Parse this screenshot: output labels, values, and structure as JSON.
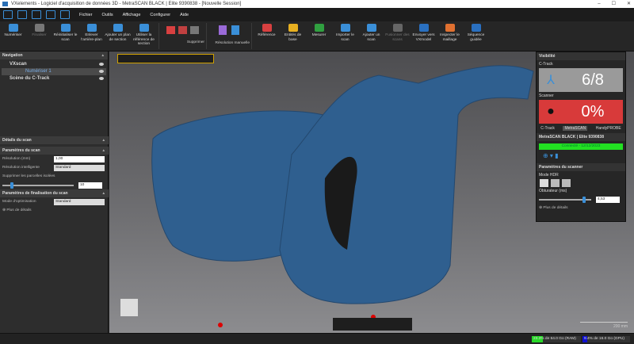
{
  "window": {
    "title": "VXelements - Logiciel d'acquisition de données 3D - MetraSCAN BLACK | Elite 9390838 - [Nouvelle Session]",
    "min": "–",
    "max": "☐",
    "close": "✕"
  },
  "menu": [
    "Fichier",
    "Outils",
    "Affichage",
    "Configurer",
    "Aide"
  ],
  "ribbon": {
    "buttons": [
      {
        "label": "Numériser",
        "color": "#3a8fd8",
        "enabled": true
      },
      {
        "label": "Finaliser",
        "color": "#777777",
        "enabled": false
      },
      {
        "label": "Réinitialiser le scan",
        "color": "#3a8fd8",
        "enabled": true
      },
      {
        "label": "Enlever l'arrière-plan",
        "color": "#3a8fd8",
        "enabled": true
      },
      {
        "label": "Ajouter un plan de section",
        "color": "#3a8fd8",
        "enabled": true
      },
      {
        "label": "Utiliser la référence de section",
        "color": "#3a8fd8",
        "enabled": true
      }
    ],
    "group_delete": "Supprimer",
    "group_resolution": "Résolution manuelle",
    "buttons2": [
      {
        "label": "Référence",
        "color": "#d84040",
        "enabled": true
      },
      {
        "label": "Entités de base",
        "color": "#e8b020",
        "enabled": true
      },
      {
        "label": "Mesurer",
        "color": "#30a040",
        "enabled": true
      },
      {
        "label": "Importer le scan",
        "color": "#3a8fd8",
        "enabled": true
      },
      {
        "label": "Ajouter un scan",
        "color": "#3a8fd8",
        "enabled": true
      },
      {
        "label": "Fusionner des scans",
        "color": "#666666",
        "enabled": false
      },
      {
        "label": "Envoyer vers VXmodel",
        "color": "#2a70c0",
        "enabled": true
      },
      {
        "label": "Inspecter le maillage",
        "color": "#e07030",
        "enabled": true
      },
      {
        "label": "Séquence guidée",
        "color": "#2a70c0",
        "enabled": true
      }
    ]
  },
  "left": {
    "navigation": "Navigation",
    "tree": {
      "root": "VXscan",
      "child": "Numériser 1",
      "ctrack": "Scène du C-Track"
    },
    "details": "Détails du scan",
    "scan_params": {
      "title": "Paramètres du scan",
      "resolution_label": "Résolution (mm)",
      "resolution_value": "1,00",
      "smart_label": "Résolution intelligente",
      "smart_value": "Standard",
      "isolated_label": "Supprimer les parcelles isolées",
      "isolated_value": "10"
    },
    "final_params": {
      "title": "Paramètres de finalisation du scan",
      "mode_label": "Mode d'optimisation",
      "mode_value": "Standard",
      "more": "Plus de détails"
    }
  },
  "visibility": {
    "title": "Visibilité",
    "ctrack_label": "C-Track",
    "ctrack_value": "6/8",
    "ctrack_color": "#9a9a9a",
    "scanner_label": "Scanner",
    "scanner_value": "0%",
    "scanner_color": "#d83a3a",
    "tabs": [
      "C-Track",
      "MetraSCAN",
      "HandyPROBE"
    ],
    "active_tab": "MetraSCAN",
    "device": "MetraSCAN BLACK | Elite 9390838",
    "connection": "Connecté - 12/12/2023",
    "scanner_params": "Paramètres du scanner",
    "hdr": "Mode HDR",
    "shutter_label": "Obturateur (ms)",
    "shutter_value": "4,53",
    "more": "Plus de détails"
  },
  "viewport": {
    "scale": "200 mm",
    "model_color": "#2f5f8f"
  },
  "status": {
    "ram": "23.3% de 64.0 Go (RAM)",
    "ram_pct": 23.3,
    "gpu": "9.4% de 16.0 Go (GPU)",
    "gpu_pct": 9.4
  }
}
